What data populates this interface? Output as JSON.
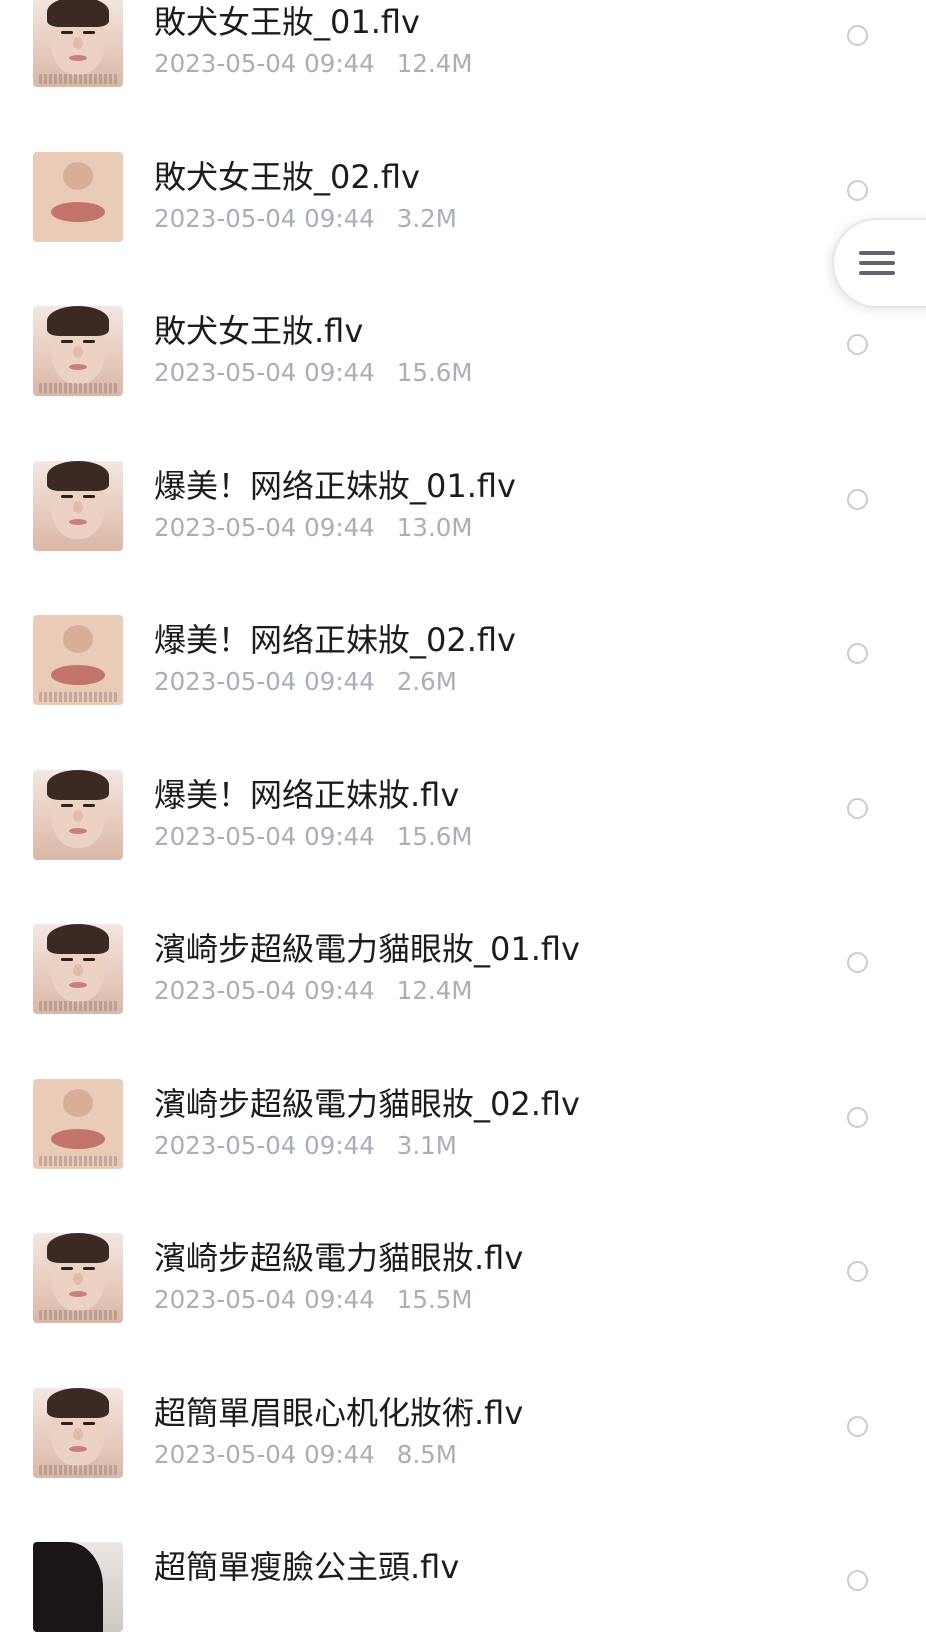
{
  "files": [
    {
      "name": "敗犬女王妝_01.flv",
      "date": "2023-05-04 09:44",
      "size": "12.4M",
      "thumb": "face"
    },
    {
      "name": "敗犬女王妝_02.flv",
      "date": "2023-05-04 09:44",
      "size": "3.2M",
      "thumb": "lips"
    },
    {
      "name": "敗犬女王妝.flv",
      "date": "2023-05-04 09:44",
      "size": "15.6M",
      "thumb": "face"
    },
    {
      "name": "爆美！网络正妹妝_01.flv",
      "date": "2023-05-04 09:44",
      "size": "13.0M",
      "thumb": "face"
    },
    {
      "name": "爆美！网络正妹妝_02.flv",
      "date": "2023-05-04 09:44",
      "size": "2.6M",
      "thumb": "lips"
    },
    {
      "name": "爆美！网络正妹妝.flv",
      "date": "2023-05-04 09:44",
      "size": "15.6M",
      "thumb": "face"
    },
    {
      "name": "濱崎步超級電力貓眼妝_01.flv",
      "date": "2023-05-04 09:44",
      "size": "12.4M",
      "thumb": "face"
    },
    {
      "name": "濱崎步超級電力貓眼妝_02.flv",
      "date": "2023-05-04 09:44",
      "size": "3.1M",
      "thumb": "lips"
    },
    {
      "name": "濱崎步超級電力貓眼妝.flv",
      "date": "2023-05-04 09:44",
      "size": "15.5M",
      "thumb": "face"
    },
    {
      "name": "超簡單眉眼心机化妝術.flv",
      "date": "2023-05-04 09:44",
      "size": "8.5M",
      "thumb": "face"
    },
    {
      "name": "超簡單瘦臉公主頭.flv",
      "date": "",
      "size": "",
      "thumb": "dark"
    }
  ],
  "floating_menu": {
    "icon": "hamburger-menu-icon"
  }
}
